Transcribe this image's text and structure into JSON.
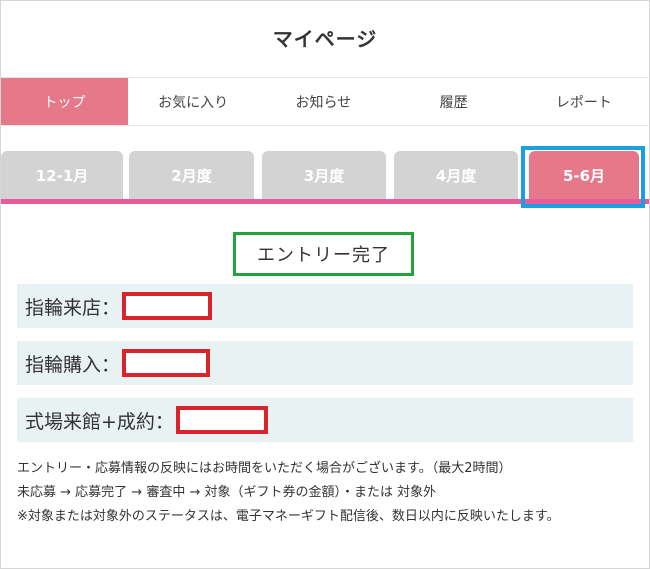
{
  "header": {
    "title": "マイページ"
  },
  "nav": {
    "items": [
      {
        "label": "トップ",
        "active": true
      },
      {
        "label": "お気に入り",
        "active": false
      },
      {
        "label": "お知らせ",
        "active": false
      },
      {
        "label": "履歴",
        "active": false
      },
      {
        "label": "レポート",
        "active": false
      }
    ]
  },
  "month_tabs": {
    "items": [
      {
        "label": "12-1月",
        "active": false
      },
      {
        "label": "2月度",
        "active": false
      },
      {
        "label": "3月度",
        "active": false
      },
      {
        "label": "4月度",
        "active": false
      },
      {
        "label": "5-6月",
        "active": true
      }
    ]
  },
  "entry": {
    "status": "エントリー完了",
    "rows": [
      {
        "label": "指輪来店："
      },
      {
        "label": "指輪購入："
      },
      {
        "label": "式場来館+成約："
      }
    ]
  },
  "notes": [
    "エントリー・応募情報の反映にはお時間をいただく場合がございます。（最大2時間）",
    "未応募 → 応募完了 → 審査中 → 対象（ギフト券の金額）・または 対象外",
    "※対象または対象外のステータスは、電子マネーギフト配信後、数日以内に反映いたします。"
  ],
  "colors": {
    "accent_pink": "#e5798a",
    "underline_pink": "#e85a9a",
    "tab_inactive": "#d3d3d3",
    "highlight_blue": "#1aa0e0",
    "highlight_green": "#22a33b",
    "redaction_red": "#d9242b",
    "row_background": "#e9f2f3"
  }
}
